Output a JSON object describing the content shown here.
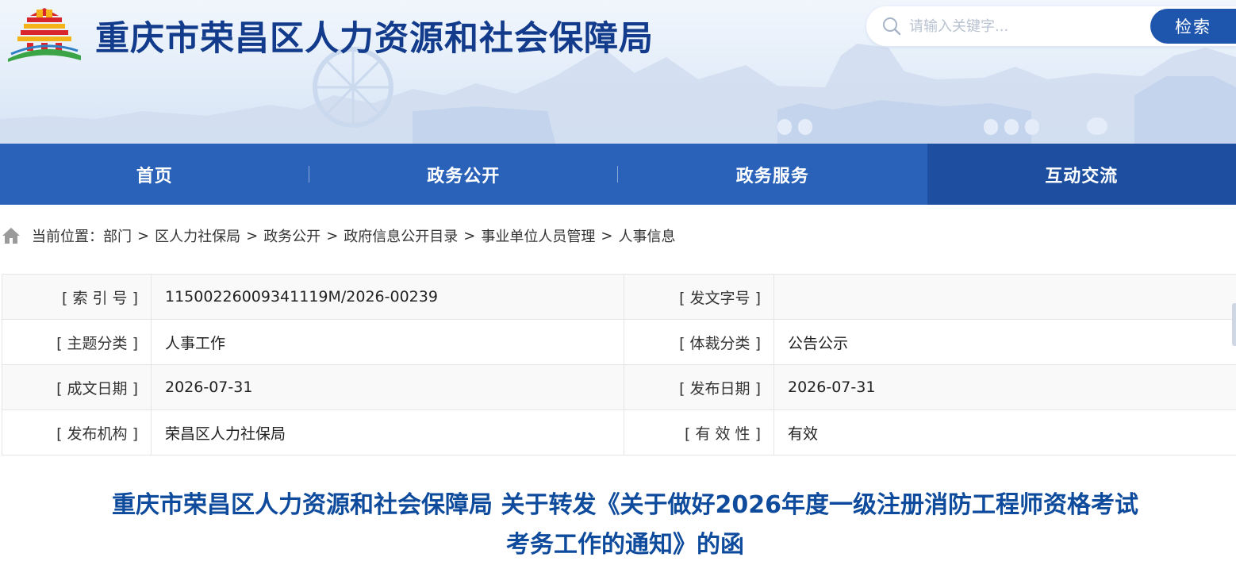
{
  "header": {
    "site_title": "重庆市荣昌区人力资源和社会保障局",
    "search": {
      "placeholder": "请输入关键字...",
      "button_label": "检索"
    }
  },
  "nav": {
    "items": [
      {
        "label": "首页"
      },
      {
        "label": "政务公开"
      },
      {
        "label": "政务服务"
      },
      {
        "label": "互动交流"
      }
    ],
    "active_index": 3
  },
  "breadcrumb": {
    "prefix": "当前位置：",
    "items": [
      "部门",
      "区人力社保局",
      "政务公开",
      "政府信息公开目录",
      "事业单位人员管理",
      "人事信息"
    ],
    "separator": ">"
  },
  "meta": {
    "rows": [
      {
        "label1": "[ 索  引  号 ]",
        "value1": "11500226009341119M/2026-00239",
        "label2": "[ 发文字号 ]",
        "value2": ""
      },
      {
        "label1": "[ 主题分类 ]",
        "value1": "人事工作",
        "label2": "[ 体裁分类 ]",
        "value2": "公告公示"
      },
      {
        "label1": "[ 成文日期 ]",
        "value1": "2026-07-31",
        "label2": "[ 发布日期 ]",
        "value2": "2026-07-31"
      },
      {
        "label1": "[ 发布机构 ]",
        "value1": "荣昌区人力社保局",
        "label2": "[ 有  效  性 ]",
        "value2": "有效"
      }
    ]
  },
  "article": {
    "title_line1": "重庆市荣昌区人力资源和社会保障局 关于转发《关于做好2026年度一级注册消防工程师资格考试",
    "title_line2": "考务工作的通知》的函"
  },
  "colors": {
    "brand_blue": "#123b8c",
    "nav_blue": "#2b62b9",
    "nav_active": "#1e4ea0",
    "title_blue": "#0e4b9c",
    "logo_red": "#d9262c",
    "logo_yellow": "#f4b318",
    "logo_green": "#3aa447"
  },
  "icons": {
    "logo": "rongchang-logo",
    "search": "search-icon",
    "home": "home-icon"
  }
}
